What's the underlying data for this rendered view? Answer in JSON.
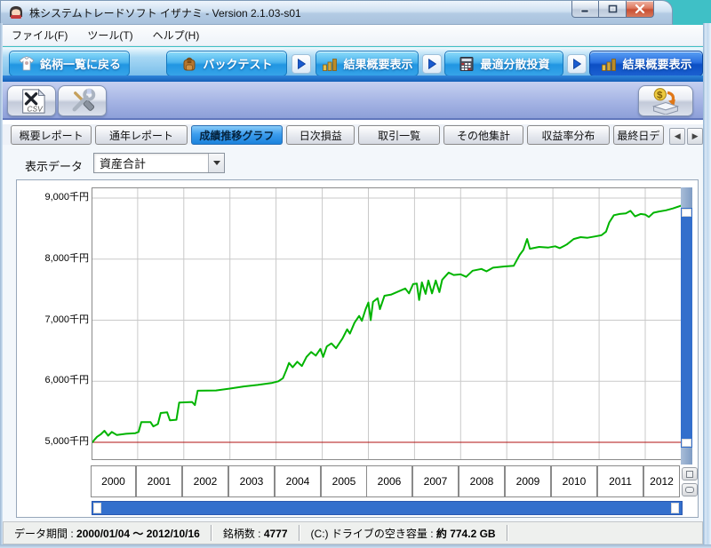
{
  "window": {
    "title": "株システムトレードソフト イザナミ - Version 2.1.03-s01"
  },
  "menu_bar": {
    "items": [
      "ファイル(F)",
      "ツール(T)",
      "ヘルプ(H)"
    ]
  },
  "nav_toolbar": {
    "buttons": [
      {
        "label": "銘柄一覧に戻る",
        "icon": "shirt-icon",
        "active": false
      },
      {
        "label": "バックテスト",
        "icon": "backpack-icon",
        "active": false
      },
      {
        "label": "結果概要表示",
        "icon": "bar-chart-icon",
        "active": false
      },
      {
        "label": "最適分散投資",
        "icon": "calculator-icon",
        "active": false
      },
      {
        "label": "結果概要表示",
        "icon": "bar-chart-icon",
        "active": true
      }
    ]
  },
  "toolbar": {
    "csv_button": "CSV",
    "tools_button": "tools",
    "money_button": "payout"
  },
  "tabs": {
    "items": [
      {
        "label": "概要レポート",
        "active": false
      },
      {
        "label": "通年レポート",
        "active": false
      },
      {
        "label": "成績推移グラフ",
        "active": true
      },
      {
        "label": "日次損益",
        "active": false
      },
      {
        "label": "取引一覧",
        "active": false
      },
      {
        "label": "その他集計",
        "active": false
      },
      {
        "label": "収益率分布",
        "active": false
      },
      {
        "label": "最終日デ",
        "active": false
      }
    ],
    "scroll_left": "◀",
    "scroll_right": "▶"
  },
  "display_data": {
    "label": "表示データ",
    "value": "資産合計"
  },
  "chart_data": {
    "type": "line",
    "xlabel": "",
    "ylabel": "千円",
    "x_ticks": [
      "2000",
      "2001",
      "2002",
      "2003",
      "2004",
      "2005",
      "2006",
      "2007",
      "2008",
      "2009",
      "2010",
      "2011",
      "2012"
    ],
    "y_ticks": [
      {
        "value": 9000,
        "label": "9,000千円"
      },
      {
        "value": 8000,
        "label": "8,000千円"
      },
      {
        "value": 7000,
        "label": "7,000千円"
      },
      {
        "value": 6000,
        "label": "6,000千円"
      },
      {
        "value": 5000,
        "label": "5,000千円"
      }
    ],
    "xlim": [
      2000.02,
      2012.79
    ],
    "ylim": [
      4724,
      9160
    ],
    "grid": true,
    "grid_color": "#c9c9c9",
    "reference_line": {
      "value": 5000,
      "color": "#b01010"
    },
    "series": [
      {
        "name": "資産合計",
        "color": "#00b400",
        "points": [
          [
            2000.02,
            5000
          ],
          [
            2000.06,
            5040
          ],
          [
            2000.12,
            5090
          ],
          [
            2000.2,
            5130
          ],
          [
            2000.28,
            5190
          ],
          [
            2000.36,
            5110
          ],
          [
            2000.44,
            5170
          ],
          [
            2000.55,
            5120
          ],
          [
            2000.75,
            5140
          ],
          [
            2000.95,
            5150
          ],
          [
            2001.02,
            5170
          ],
          [
            2001.08,
            5330
          ],
          [
            2001.28,
            5330
          ],
          [
            2001.34,
            5260
          ],
          [
            2001.44,
            5300
          ],
          [
            2001.5,
            5480
          ],
          [
            2001.64,
            5490
          ],
          [
            2001.7,
            5360
          ],
          [
            2001.84,
            5370
          ],
          [
            2001.9,
            5650
          ],
          [
            2002.18,
            5660
          ],
          [
            2002.24,
            5610
          ],
          [
            2002.3,
            5845
          ],
          [
            2002.7,
            5850
          ],
          [
            2003.0,
            5880
          ],
          [
            2003.3,
            5915
          ],
          [
            2003.6,
            5940
          ],
          [
            2003.9,
            5970
          ],
          [
            2004.05,
            6000
          ],
          [
            2004.15,
            6050
          ],
          [
            2004.22,
            6180
          ],
          [
            2004.28,
            6300
          ],
          [
            2004.36,
            6230
          ],
          [
            2004.46,
            6320
          ],
          [
            2004.56,
            6250
          ],
          [
            2004.66,
            6400
          ],
          [
            2004.76,
            6480
          ],
          [
            2004.86,
            6420
          ],
          [
            2004.96,
            6530
          ],
          [
            2005.02,
            6400
          ],
          [
            2005.1,
            6570
          ],
          [
            2005.2,
            6620
          ],
          [
            2005.3,
            6540
          ],
          [
            2005.44,
            6700
          ],
          [
            2005.54,
            6850
          ],
          [
            2005.6,
            6780
          ],
          [
            2005.7,
            6960
          ],
          [
            2005.8,
            7070
          ],
          [
            2005.86,
            6990
          ],
          [
            2005.94,
            7180
          ],
          [
            2006.0,
            7290
          ],
          [
            2006.05,
            7000
          ],
          [
            2006.1,
            7300
          ],
          [
            2006.2,
            7360
          ],
          [
            2006.25,
            7180
          ],
          [
            2006.35,
            7400
          ],
          [
            2006.5,
            7420
          ],
          [
            2006.65,
            7470
          ],
          [
            2006.8,
            7520
          ],
          [
            2006.88,
            7440
          ],
          [
            2006.97,
            7590
          ],
          [
            2007.05,
            7600
          ],
          [
            2007.1,
            7330
          ],
          [
            2007.16,
            7620
          ],
          [
            2007.24,
            7430
          ],
          [
            2007.3,
            7650
          ],
          [
            2007.38,
            7440
          ],
          [
            2007.46,
            7650
          ],
          [
            2007.54,
            7460
          ],
          [
            2007.6,
            7660
          ],
          [
            2007.74,
            7780
          ],
          [
            2007.85,
            7740
          ],
          [
            2008.0,
            7750
          ],
          [
            2008.12,
            7710
          ],
          [
            2008.26,
            7810
          ],
          [
            2008.45,
            7840
          ],
          [
            2008.56,
            7800
          ],
          [
            2008.7,
            7860
          ],
          [
            2008.95,
            7880
          ],
          [
            2009.15,
            7890
          ],
          [
            2009.28,
            8070
          ],
          [
            2009.36,
            8150
          ],
          [
            2009.44,
            8330
          ],
          [
            2009.5,
            8170
          ],
          [
            2009.7,
            8200
          ],
          [
            2009.9,
            8190
          ],
          [
            2010.05,
            8210
          ],
          [
            2010.15,
            8180
          ],
          [
            2010.3,
            8240
          ],
          [
            2010.45,
            8330
          ],
          [
            2010.6,
            8360
          ],
          [
            2010.75,
            8350
          ],
          [
            2010.9,
            8370
          ],
          [
            2011.05,
            8390
          ],
          [
            2011.15,
            8450
          ],
          [
            2011.22,
            8600
          ],
          [
            2011.32,
            8720
          ],
          [
            2011.45,
            8740
          ],
          [
            2011.58,
            8750
          ],
          [
            2011.68,
            8790
          ],
          [
            2011.78,
            8700
          ],
          [
            2011.9,
            8740
          ],
          [
            2012.0,
            8730
          ],
          [
            2012.08,
            8690
          ],
          [
            2012.18,
            8760
          ],
          [
            2012.3,
            8780
          ],
          [
            2012.45,
            8800
          ],
          [
            2012.6,
            8830
          ],
          [
            2012.79,
            8880
          ]
        ]
      }
    ]
  },
  "status_bar": {
    "segments": [
      {
        "label": "データ期間 :",
        "value": "2000/01/04 ～ 2012/10/16"
      },
      {
        "label": "銘柄数 :",
        "value": "4777"
      },
      {
        "label": "(C:) ドライブの空き容量 :",
        "value": "約 774.2 GB"
      }
    ]
  }
}
